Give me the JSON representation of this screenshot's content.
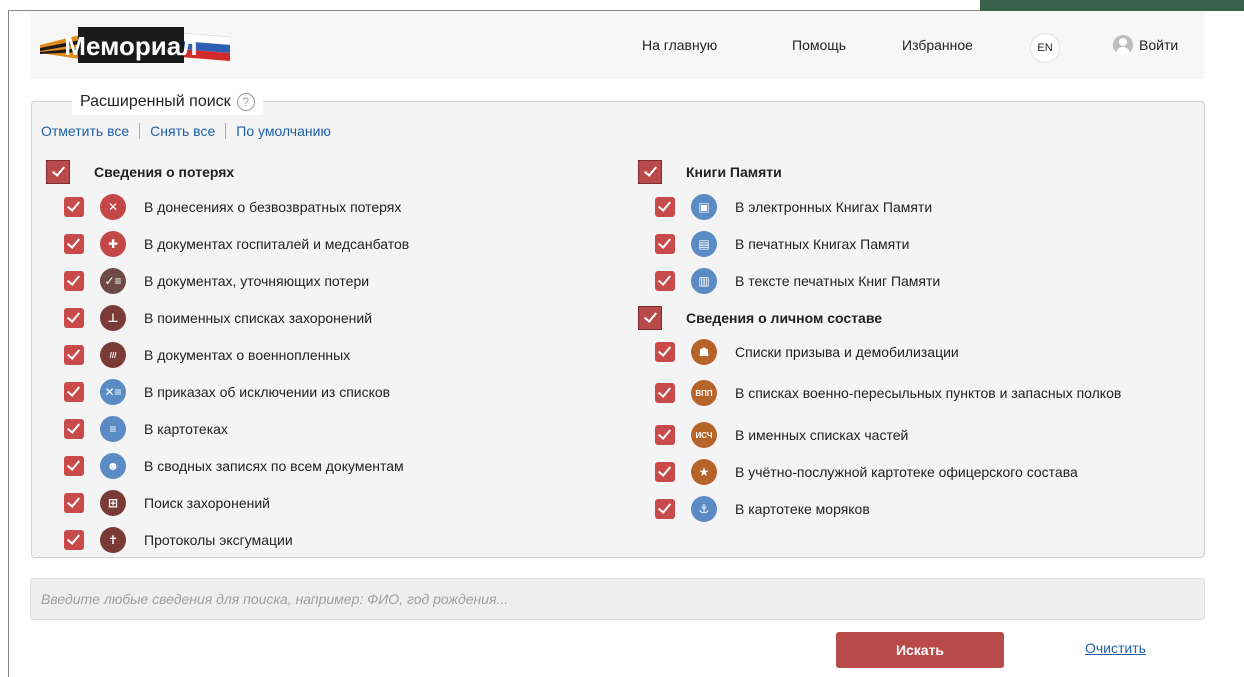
{
  "header": {
    "logo_text": "Мемориал",
    "nav": {
      "home": "На главную",
      "help": "Помощь",
      "favorites": "Избранное",
      "lang": "EN",
      "login": "Войти"
    }
  },
  "panel": {
    "title": "Расширенный поиск",
    "help": "?",
    "links": {
      "check_all": "Отметить все",
      "uncheck_all": "Снять все",
      "default": "По умолчанию"
    },
    "groups": [
      {
        "title": "Сведения о потерях",
        "items": [
          {
            "label": "В донесениях о безвозвратных потерях",
            "icon": "close-icon",
            "glyph": "✕",
            "color": "red"
          },
          {
            "label": "В документах госпиталей и медсанбатов",
            "icon": "medical-cross-icon",
            "glyph": "✚",
            "color": "red"
          },
          {
            "label": "В документах, уточняющих потери",
            "icon": "checklist-icon",
            "glyph": "✓≡",
            "color": "dark"
          },
          {
            "label": "В поименных списках захоронений",
            "icon": "gravestone-icon",
            "glyph": "⊥",
            "color": "brown"
          },
          {
            "label": "В документах о военнопленных",
            "icon": "bars-icon",
            "glyph": "///",
            "color": "brown"
          },
          {
            "label": "В приказах об исключении из списков",
            "icon": "exclude-list-icon",
            "glyph": "✕≡",
            "color": "blue"
          },
          {
            "label": "В картотеках",
            "icon": "card-index-icon",
            "glyph": "≡",
            "color": "blue"
          },
          {
            "label": "В сводных записях по всем документам",
            "icon": "person-icon",
            "glyph": "☻",
            "color": "blue"
          },
          {
            "label": "Поиск захоронений",
            "icon": "memorial-icon",
            "glyph": "⊞",
            "color": "brown"
          },
          {
            "label": "Протоколы эксгумации",
            "icon": "exhumation-icon",
            "glyph": "✝",
            "color": "brown"
          }
        ]
      },
      {
        "title": "Книги Памяти",
        "items": [
          {
            "label": "В электронных Книгах Памяти",
            "icon": "ebook-icon",
            "glyph": "▣",
            "color": "blue"
          },
          {
            "label": "В печатных Книгах Памяти",
            "icon": "printed-book-icon",
            "glyph": "▤",
            "color": "blue"
          },
          {
            "label": "В тексте печатных Книг Памяти",
            "icon": "book-text-icon",
            "glyph": "▥",
            "color": "blue"
          }
        ]
      },
      {
        "title": "Сведения о личном составе",
        "items": [
          {
            "label": "Списки призыва и демобилизации",
            "icon": "soldier-icon",
            "glyph": "☗",
            "color": "orange"
          },
          {
            "label": "В списках военно-пересыльных пунктов и запасных полков",
            "icon": "vpp-icon",
            "glyph": "ВПП",
            "color": "orange"
          },
          {
            "label": "В именных списках частей",
            "icon": "isch-icon",
            "glyph": "ИСЧ",
            "color": "orange"
          },
          {
            "label": "В учётно-послужной картотеке офицерского состава",
            "icon": "star-icon",
            "glyph": "★",
            "color": "orange"
          },
          {
            "label": "В картотеке моряков",
            "icon": "anchor-icon",
            "glyph": "⚓",
            "color": "blue"
          }
        ]
      }
    ]
  },
  "search": {
    "placeholder": "Введите любые сведения для поиска, например: ФИО, год рождения...",
    "button": "Искать",
    "clear": "Очистить"
  },
  "colors": {
    "accent_red": "#b94a4a",
    "link_blue": "#1f5fa8",
    "icon_blue": "#5a8bc4",
    "icon_orange": "#b7642b",
    "icon_brown": "#7a3b36",
    "corner_green": "#37614a"
  }
}
